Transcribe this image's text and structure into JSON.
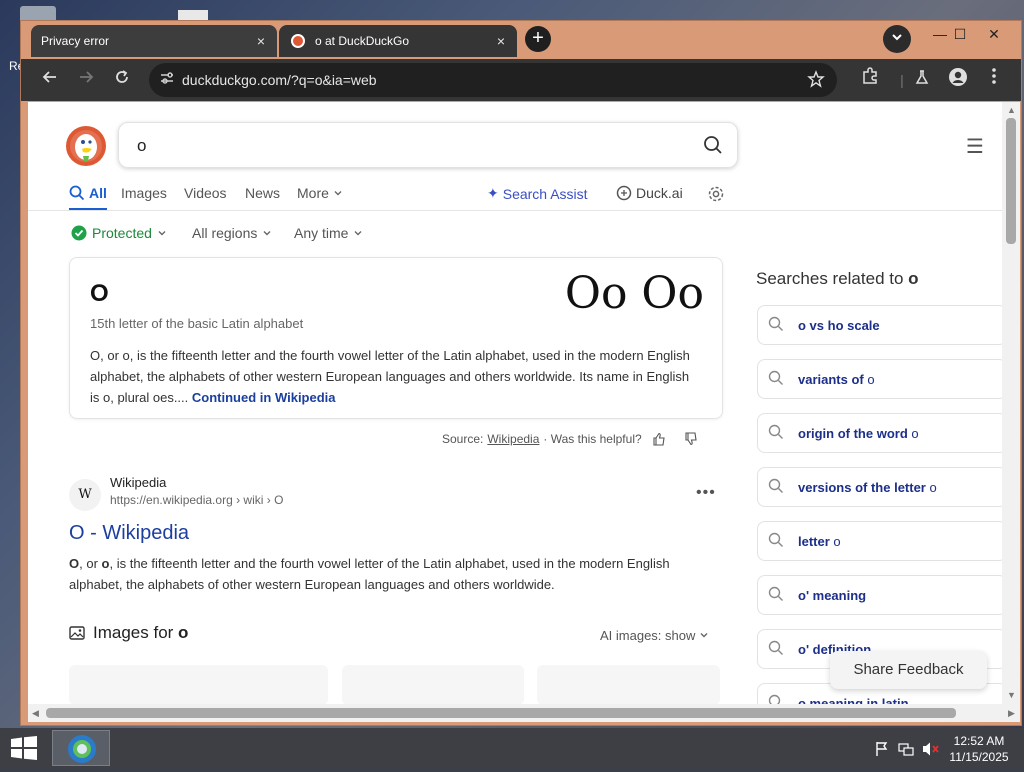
{
  "desktop": {
    "icon_label": "Re"
  },
  "browser": {
    "tabs": [
      {
        "title": "Privacy error",
        "close": "×"
      },
      {
        "title": "o at DuckDuckGo",
        "close": "×"
      }
    ],
    "new_tab": "+",
    "window_controls": {
      "minimize": "—",
      "maximize": "☐",
      "close": "✕"
    },
    "url": "duckduckgo.com/?q=o&ia=web"
  },
  "search": {
    "query": "o",
    "tabs": {
      "all": "All",
      "images": "Images",
      "videos": "Videos",
      "news": "News",
      "more": "More"
    },
    "search_assist": "Search Assist",
    "duck_ai": "Duck.ai",
    "filters": {
      "protected": "Protected",
      "regions": "All regions",
      "time": "Any time"
    }
  },
  "infobox": {
    "title": "O",
    "glyphs": "Oo Oo",
    "subtitle": "15th letter of the basic Latin alphabet",
    "description": "O, or o, is the fifteenth letter and the fourth vowel letter of the Latin alphabet, used in the modern English alphabet, the alphabets of other western European languages and others worldwide. Its name in English is o, plural oes....",
    "more_link": "Continued in Wikipedia",
    "source_label": "Source:",
    "source_link": "Wikipedia",
    "helpful": "· Was this helpful?"
  },
  "result": {
    "favicon": "W",
    "site": "Wikipedia",
    "url": "https://en.wikipedia.org › wiki › O",
    "title": "O - Wikipedia",
    "snippet_start": "O",
    "snippet_mid": ", or ",
    "snippet_o": "o",
    "snippet_rest": ", is the fifteenth letter and the fourth vowel letter of the Latin alphabet, used in the modern English alphabet, the alphabets of other western European languages and others worldwide."
  },
  "images": {
    "heading": "Images for",
    "query": "o",
    "ai_toggle": "AI images: show"
  },
  "related": {
    "heading": "Searches related to",
    "query": "o",
    "items": [
      {
        "bold": "o vs ho scale",
        "rest": ""
      },
      {
        "bold": "variants of",
        "rest": " o"
      },
      {
        "bold": "origin of the word",
        "rest": " o"
      },
      {
        "bold": "versions of the letter",
        "rest": " o"
      },
      {
        "bold": "letter",
        "rest": " o"
      },
      {
        "bold": "o' meaning",
        "rest": ""
      },
      {
        "bold": "o' definition",
        "rest": ""
      },
      {
        "bold": "o meaning in latin",
        "rest": ""
      }
    ],
    "feedback": "Share Feedback"
  },
  "taskbar": {
    "time": "12:52 AM",
    "date": "11/15/2025"
  },
  "colors": {
    "accent": "#1a5fd0",
    "brand": "#de5833",
    "link": "#1c3ea0"
  }
}
